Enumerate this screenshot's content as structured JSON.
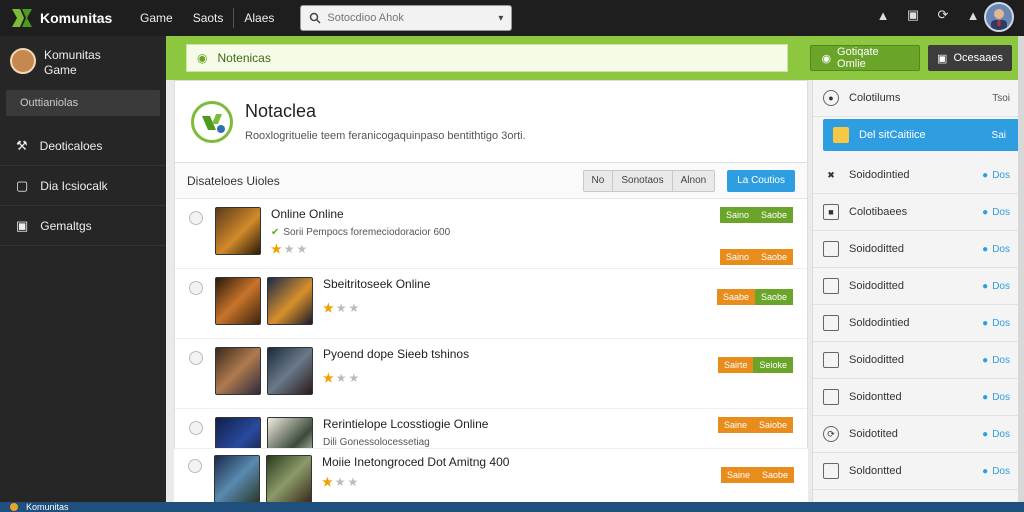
{
  "app": {
    "name": "Komunitas",
    "accent": "#8dc63f",
    "blue": "#2e9ee0"
  },
  "topnav": {
    "items": [
      "Game",
      "Saots",
      "Alaes"
    ]
  },
  "search": {
    "placeholder": "Sotocdioo Ahok"
  },
  "topbar": {
    "icons": [
      "alien-icon",
      "camera-icon",
      "refresh-icon",
      "notification-icon"
    ]
  },
  "sidebar": {
    "user_name": "Komunitas",
    "user_sub": "Game",
    "active_label": "Outtianiolas",
    "items": [
      {
        "label": "Deoticaloes",
        "icon": "wrench-icon"
      },
      {
        "label": "Dia Icsiocalk",
        "icon": "monitor-icon"
      },
      {
        "label": "Gemaltgs",
        "icon": "camera-icon"
      }
    ]
  },
  "notice": {
    "text": "Notenicas"
  },
  "header_buttons": {
    "green": "Gotiqate Omlie",
    "dark": "Ocesaaes"
  },
  "profile_header": {
    "title": "Notaclea",
    "subtitle": "Rooxlogrituelie teem feranicogaquinpaso bentithtigo 3orti."
  },
  "list": {
    "title": "Disateloes Uioles",
    "seg": [
      "No",
      "Sonotaos",
      "Alnon"
    ],
    "blue_button": "La Coutios",
    "rows": [
      {
        "title": "Online Online",
        "sub": "Sorii Pempocs foremeciodoracior 600",
        "stars_filled": 1,
        "btn1": "Saino",
        "btn2": "Saobe",
        "btn1_color": "green"
      },
      {
        "title": "Sbeitritoseek Online",
        "sub": "",
        "stars_filled": 1,
        "btn1": "Saabe",
        "btn2": "Saobe",
        "btn1_color": "orange"
      },
      {
        "title": "Pyoend dope Sieeb tshinos",
        "sub": "",
        "stars_filled": 1,
        "btn1": "Sairte",
        "btn2": "Seioke",
        "btn1_color": "orange"
      },
      {
        "title": "Rerintielope Lcosstiogie Online",
        "sub": "Dili Gonessolocessetiag",
        "stars_filled": 1,
        "btn1": "Saine",
        "btn2": "Saiobe",
        "btn1_color": "orange"
      },
      {
        "title": "Moiie Inetongroced Dot Amitng 400",
        "sub": "",
        "stars_filled": 1,
        "btn1": "Saine",
        "btn2": "Saobe",
        "btn1_color": "orange"
      }
    ]
  },
  "panel": {
    "items": [
      {
        "label": "Colotilums",
        "right": "Tsoi",
        "icon": "user-icon"
      },
      {
        "label": "Del sitCaitiice",
        "right": "Sai",
        "icon": "folder-icon",
        "active": true
      },
      {
        "label": "Soidodintied",
        "right": "Dos",
        "icon": "tool-icon"
      },
      {
        "label": "Colotibaees",
        "right": "Dos",
        "icon": "chart-icon"
      },
      {
        "label": "Soidoditted",
        "right": "Dos",
        "icon": "box-icon"
      },
      {
        "label": "Soidoditted",
        "right": "Dos",
        "icon": "box-icon"
      },
      {
        "label": "Soldodintied",
        "right": "Dos",
        "icon": "box-icon"
      },
      {
        "label": "Soidoditted",
        "right": "Dos",
        "icon": "box-icon"
      },
      {
        "label": "Soidontted",
        "right": "Dos",
        "icon": "box-icon"
      },
      {
        "label": "Soidotited",
        "right": "Dos",
        "icon": "refresh-icon"
      },
      {
        "label": "Soldontted",
        "right": "Dos",
        "icon": "box-icon"
      }
    ]
  },
  "taskbar": {
    "label": "Komunitas"
  }
}
